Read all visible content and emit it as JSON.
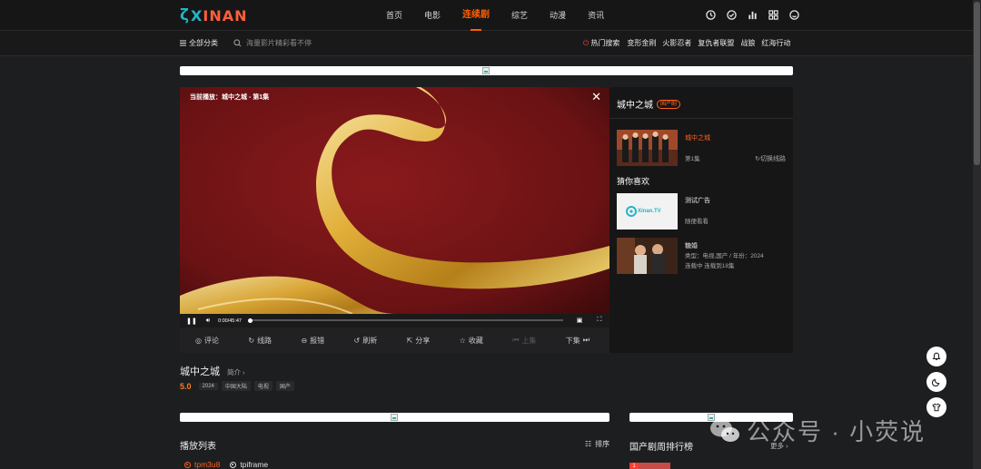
{
  "header": {
    "logo_mark": "ζ",
    "logo_x": "X",
    "logo_rest": "INAN",
    "nav": [
      "首页",
      "电影",
      "连续剧",
      "综艺",
      "动漫",
      "资讯"
    ],
    "active_nav": "连续剧"
  },
  "subnav": {
    "all_label": "全部分类",
    "search_placeholder": "海量影片精彩看不停",
    "hot_label": "热门搜索",
    "hot_keywords": [
      "变形金刚",
      "火影忍者",
      "复仇者联盟",
      "战狼",
      "红海行动"
    ]
  },
  "player": {
    "now_playing": "当前播放：城中之城 - 第1集",
    "time": "0:00/45:47",
    "progress": 0.0
  },
  "toolbar": {
    "comment": "评论",
    "route": "线路",
    "report": "报错",
    "refresh": "刷新",
    "share": "分享",
    "favorite": "收藏",
    "prev": "上集",
    "next": "下集"
  },
  "side": {
    "title": "城中之城",
    "tag": "国产剧",
    "current": {
      "title": "城中之城",
      "episode": "第1集",
      "switch": "切换线路"
    },
    "guess_label": "猜你喜欢",
    "recommendations": [
      {
        "title": "测试广告",
        "line1": "随便看看",
        "line2": ""
      },
      {
        "title": "糖婚",
        "line1": "类型：电视,国产 / 年份：2024",
        "line2": "连载中 连载到18集"
      }
    ],
    "ad_logo_text": "Xinan.TV"
  },
  "info": {
    "title": "城中之城",
    "intro": "简介",
    "score": "5.0",
    "chips": [
      "2024",
      "中国大陆",
      "电视",
      "国产"
    ]
  },
  "playlist": {
    "title": "播放列表",
    "sort": "排序",
    "sources": [
      "tpm3u8",
      "tpiframe"
    ]
  },
  "ranking": {
    "title": "国产剧周排行榜",
    "more": "更多",
    "first_badge": "1"
  },
  "watermark": {
    "text": "公众号 · 小荧说"
  },
  "colors": {
    "accent": "#ff5f00",
    "logo_cyan": "#22b6c8",
    "background": "#1d1e20"
  }
}
